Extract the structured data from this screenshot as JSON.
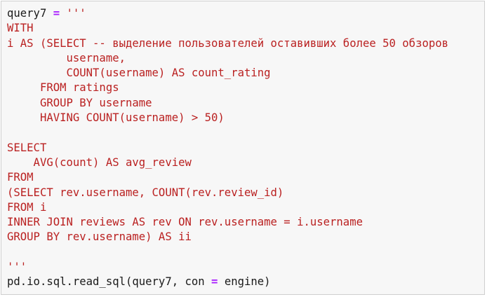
{
  "cell": {
    "lines": [
      {
        "segments": [
          {
            "text": "query7 ",
            "kind": "plain"
          },
          {
            "text": "=",
            "kind": "op"
          },
          {
            "text": " '''",
            "kind": "str"
          }
        ]
      },
      {
        "segments": [
          {
            "text": "WITH",
            "kind": "str"
          }
        ]
      },
      {
        "segments": [
          {
            "text": "i AS (SELECT -- выделение пользователей оставивших более 50 обзоров",
            "kind": "str"
          }
        ]
      },
      {
        "segments": [
          {
            "text": "         username,",
            "kind": "str"
          }
        ]
      },
      {
        "segments": [
          {
            "text": "         COUNT(username) AS count_rating",
            "kind": "str"
          }
        ]
      },
      {
        "segments": [
          {
            "text": "     FROM ratings",
            "kind": "str"
          }
        ]
      },
      {
        "segments": [
          {
            "text": "     GROUP BY username",
            "kind": "str"
          }
        ]
      },
      {
        "segments": [
          {
            "text": "     HAVING COUNT(username) > 50)",
            "kind": "str"
          }
        ]
      },
      {
        "segments": [
          {
            "text": "",
            "kind": "str"
          }
        ]
      },
      {
        "segments": [
          {
            "text": "SELECT",
            "kind": "str"
          }
        ]
      },
      {
        "segments": [
          {
            "text": "    AVG(count) AS avg_review",
            "kind": "str"
          }
        ]
      },
      {
        "segments": [
          {
            "text": "FROM",
            "kind": "str"
          }
        ]
      },
      {
        "segments": [
          {
            "text": "(SELECT rev.username, COUNT(rev.review_id)",
            "kind": "str"
          }
        ]
      },
      {
        "segments": [
          {
            "text": "FROM i",
            "kind": "str"
          }
        ]
      },
      {
        "segments": [
          {
            "text": "INNER JOIN reviews AS rev ON rev.username = i.username",
            "kind": "str"
          }
        ]
      },
      {
        "segments": [
          {
            "text": "GROUP BY rev.username) AS ii",
            "kind": "str"
          }
        ]
      },
      {
        "segments": [
          {
            "text": "",
            "kind": "str"
          }
        ]
      },
      {
        "segments": [
          {
            "text": "'''",
            "kind": "str"
          }
        ]
      },
      {
        "segments": [
          {
            "text": "pd.io.sql.read_sql(query7, con ",
            "kind": "plain"
          },
          {
            "text": "=",
            "kind": "op"
          },
          {
            "text": " engine)",
            "kind": "plain"
          }
        ]
      }
    ]
  },
  "colors": {
    "string": "#ba2121",
    "operator": "#aa22ff",
    "plain": "#1a1a1a",
    "cell_background": "#f7f7f7",
    "cell_border": "#cfcfcf"
  }
}
